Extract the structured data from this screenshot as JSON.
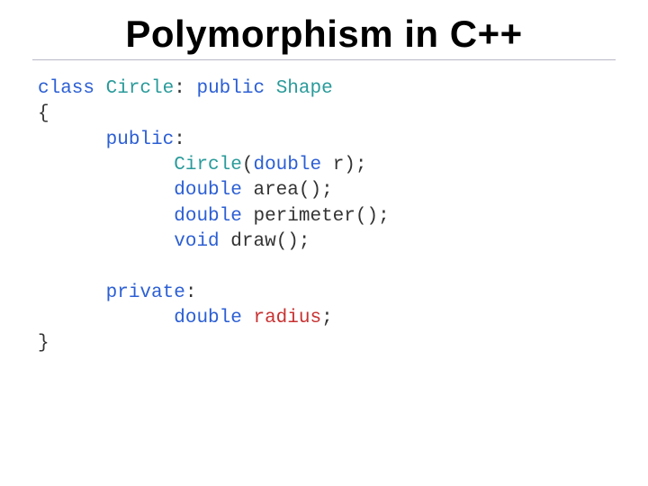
{
  "title": "Polymorphism in C++",
  "code": {
    "l1": {
      "kw_class": "class",
      "cls": "Circle",
      "colon": ":",
      "kw_pub": "public",
      "base": "Shape"
    },
    "l2": "{",
    "l3": {
      "kw_pub": "public",
      "colon": ":"
    },
    "l4": {
      "ctor": "Circle",
      "op": "(",
      "type": "double",
      "rest": " r);"
    },
    "l5": {
      "type": "double",
      "fn": "area",
      "rest": "();"
    },
    "l6": {
      "type": "double",
      "fn": "perimeter",
      "rest": "();"
    },
    "l7": {
      "type": "void",
      "fn": "draw",
      "rest": "();"
    },
    "l8": {
      "kw_priv": "private",
      "colon": ":"
    },
    "l9": {
      "type": "double",
      "mem": "radius",
      "semi": ";"
    },
    "l10": "}"
  }
}
